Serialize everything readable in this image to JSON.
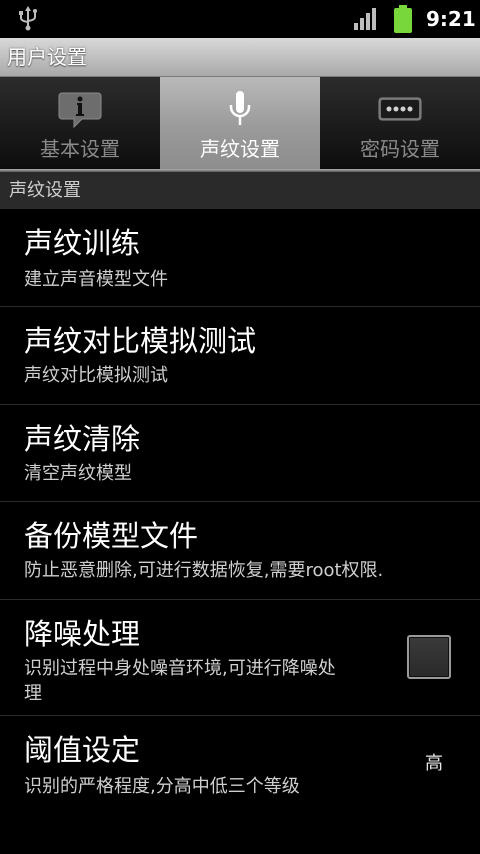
{
  "status_bar": {
    "time": "9:21",
    "icons": [
      "usb-icon",
      "signal-icon",
      "battery-icon"
    ],
    "battery_color": "#78d73a"
  },
  "title_bar": {
    "title": "用户设置"
  },
  "tabs": [
    {
      "label": "基本设置",
      "icon": "info-bubble-icon",
      "selected": false
    },
    {
      "label": "声纹设置",
      "icon": "microphone-icon",
      "selected": true
    },
    {
      "label": "密码设置",
      "icon": "password-field-icon",
      "selected": false
    }
  ],
  "section": {
    "header": "声纹设置"
  },
  "preferences": [
    {
      "title": "声纹训练",
      "summary": "建立声音模型文件"
    },
    {
      "title": "声纹对比模拟测试",
      "summary": "声纹对比模拟测试"
    },
    {
      "title": "声纹清除",
      "summary": "清空声纹模型"
    },
    {
      "title": "备份模型文件",
      "summary": "防止恶意删除,可进行数据恢复,需要root权限."
    },
    {
      "title": "降噪处理",
      "summary_line1": "识别过程中身处噪音环境,可进行降噪处",
      "summary_line2": "理",
      "checked": false
    },
    {
      "title": "阈值设定",
      "summary": "识别的严格程度,分高中低三个等级",
      "value": "高"
    }
  ]
}
